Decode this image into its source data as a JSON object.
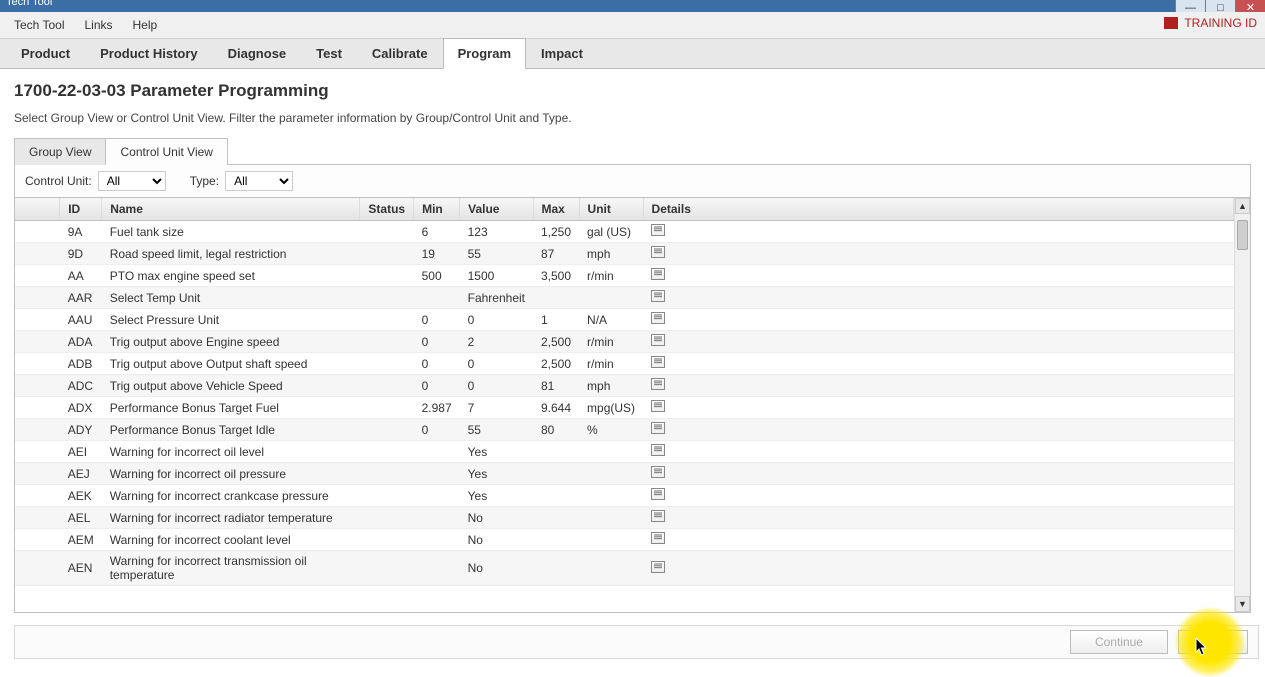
{
  "window": {
    "title": "Tech Tool"
  },
  "menubar": {
    "items": [
      "Tech Tool",
      "Links",
      "Help"
    ],
    "training_label": "TRAINING ID"
  },
  "maintabs": [
    "Product",
    "Product History",
    "Diagnose",
    "Test",
    "Calibrate",
    "Program",
    "Impact"
  ],
  "active_maintab": 5,
  "page": {
    "title": "1700-22-03-03 Parameter Programming",
    "description": "Select Group View or Control Unit View. Filter the parameter information by Group/Control Unit and Type."
  },
  "viewtabs": [
    "Group View",
    "Control Unit View"
  ],
  "active_viewtab": 0,
  "filters": {
    "control_unit_label": "Control Unit:",
    "control_unit_value": "All",
    "type_label": "Type:",
    "type_value": "All"
  },
  "columns": [
    "",
    "ID",
    "Name",
    "Status",
    "Min",
    "Value",
    "Max",
    "Unit",
    "Details"
  ],
  "rows": [
    {
      "id": "9A",
      "name": "Fuel tank size",
      "status": "",
      "min": "6",
      "value": "123",
      "max": "1,250",
      "unit": "gal (US)"
    },
    {
      "id": "9D",
      "name": "Road speed limit, legal restriction",
      "status": "",
      "min": "19",
      "value": "55",
      "max": "87",
      "unit": "mph"
    },
    {
      "id": "AA",
      "name": "PTO max engine speed set",
      "status": "",
      "min": "500",
      "value": "1500",
      "max": "3,500",
      "unit": "r/min"
    },
    {
      "id": "AAR",
      "name": "Select Temp Unit",
      "status": "",
      "min": "",
      "value": "Fahrenheit",
      "max": "",
      "unit": ""
    },
    {
      "id": "AAU",
      "name": "Select Pressure Unit",
      "status": "",
      "min": "0",
      "value": "0",
      "max": "1",
      "unit": "N/A"
    },
    {
      "id": "ADA",
      "name": "Trig output above Engine speed",
      "status": "",
      "min": "0",
      "value": "2",
      "max": "2,500",
      "unit": "r/min"
    },
    {
      "id": "ADB",
      "name": "Trig output above Output shaft speed",
      "status": "",
      "min": "0",
      "value": "0",
      "max": "2,500",
      "unit": "r/min"
    },
    {
      "id": "ADC",
      "name": "Trig output above Vehicle Speed",
      "status": "",
      "min": "0",
      "value": "0",
      "max": "81",
      "unit": "mph"
    },
    {
      "id": "ADX",
      "name": "Performance Bonus Target Fuel",
      "status": "",
      "min": "2.987",
      "value": "7",
      "max": "9.644",
      "unit": "mpg(US)"
    },
    {
      "id": "ADY",
      "name": "Performance Bonus Target Idle",
      "status": "",
      "min": "0",
      "value": "55",
      "max": "80",
      "unit": "%"
    },
    {
      "id": "AEI",
      "name": "Warning for incorrect oil level",
      "status": "",
      "min": "",
      "value": "Yes",
      "max": "",
      "unit": ""
    },
    {
      "id": "AEJ",
      "name": "Warning for incorrect oil pressure",
      "status": "",
      "min": "",
      "value": "Yes",
      "max": "",
      "unit": ""
    },
    {
      "id": "AEK",
      "name": "Warning for incorrect crankcase pressure",
      "status": "",
      "min": "",
      "value": "Yes",
      "max": "",
      "unit": ""
    },
    {
      "id": "AEL",
      "name": "Warning for incorrect radiator temperature",
      "status": "",
      "min": "",
      "value": "No",
      "max": "",
      "unit": ""
    },
    {
      "id": "AEM",
      "name": "Warning for incorrect coolant level",
      "status": "",
      "min": "",
      "value": "No",
      "max": "",
      "unit": ""
    },
    {
      "id": "AEN",
      "name": "Warning for incorrect transmission oil temperature",
      "status": "",
      "min": "",
      "value": "No",
      "max": "",
      "unit": ""
    }
  ],
  "buttons": {
    "continue": "Continue",
    "exit": "Exit"
  }
}
